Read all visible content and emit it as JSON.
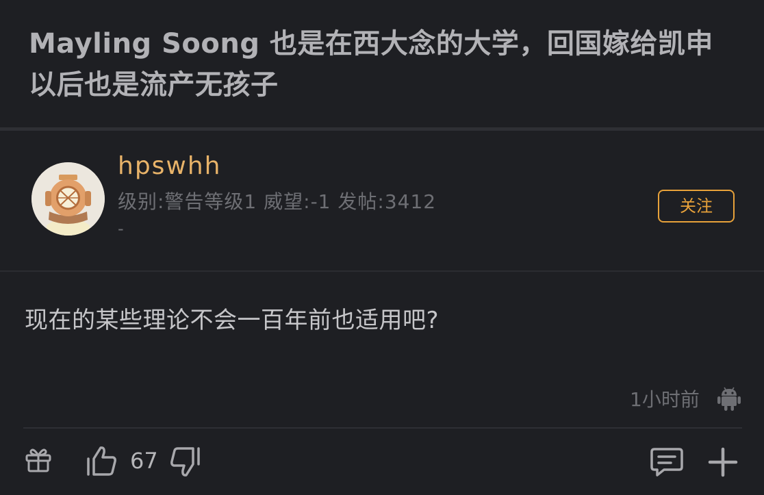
{
  "post": {
    "title": "Mayling Soong 也是在西大念的大学，回国嫁给凯申以后也是流产无孩子"
  },
  "author": {
    "username": "hpswhh",
    "meta": "级别:警告等级1 威望:-1 发帖:3412",
    "signature": "-",
    "follow_label": "关注",
    "avatar_icon": "diver-helmet-avatar"
  },
  "reply": {
    "content": "现在的某些理论不会一百年前也适用吧?",
    "time": "1小时前",
    "device_icon": "android-icon"
  },
  "actions": {
    "like_count": "67"
  },
  "colors": {
    "background": "#1e1f23",
    "accent": "#e8a23a",
    "username": "#e8b369",
    "muted": "#6e6f74"
  }
}
